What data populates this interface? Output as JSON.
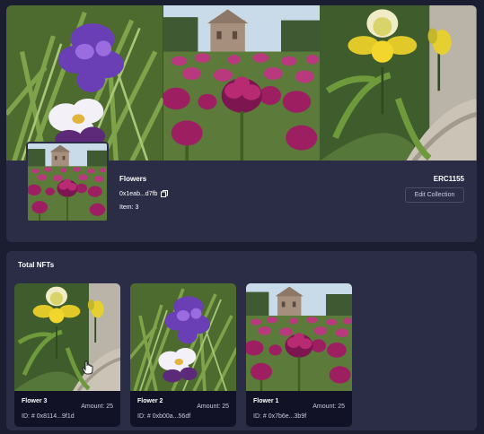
{
  "collection": {
    "name": "Flowers",
    "address": "0x1eab...d7fb",
    "items": "Item: 3",
    "standard": "ERC1155",
    "edit_label": "Edit Collection"
  },
  "nfts": {
    "title": "Total NFTs",
    "items": [
      {
        "name": "Flower 3",
        "amount": "Amount: 25",
        "id": "ID: # 0x8114...9f1d",
        "image": "yellow-orchid-photo"
      },
      {
        "name": "Flower 2",
        "amount": "Amount: 25",
        "id": "ID: # 0xb00a...56df",
        "image": "purple-iris-photo"
      },
      {
        "name": "Flower 1",
        "amount": "Amount: 25",
        "id": "ID: # 0x7b6e...3b9f",
        "image": "pink-tulips-photo"
      }
    ]
  },
  "colors": {
    "page_bg": "#1b1d30",
    "card_bg": "#2b2d47",
    "nft_card_bg": "#111225",
    "text_muted": "#c9cbe0"
  }
}
